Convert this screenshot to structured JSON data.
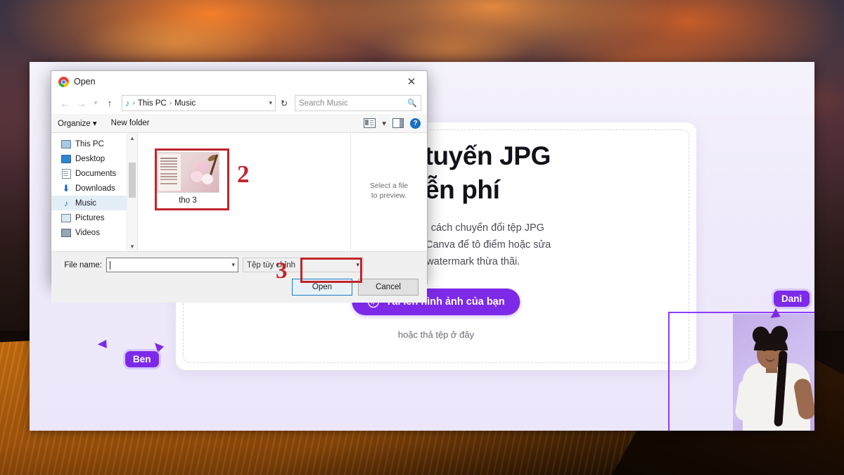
{
  "wallpaper": {
    "description": "fiery-orange-cloudy-sky-over-sand-dune"
  },
  "browser_page": {
    "heading": "…đổi trực tuyến JPG …F miễn phí",
    "heading_line1": "đổi trực tuyến JPG",
    "heading_line2": "F miễn phí",
    "paragraph_line1": "ng lượng lưu trữ bằng cách chuyển đổi tệp JPG",
    "paragraph_line2": "ảnh PDF miễn phí của Canva để tô điểm hoặc sửa",
    "paragraph_line3": "g hay phải lo về watermark thừa thãi.",
    "upload_button": "Tải lên hình ảnh của bạn",
    "upload_icon": "cloud-upload-icon",
    "drop_hint": "hoặc thả tệp ở đây",
    "accent_color": "#7d2ae8",
    "collaborators": [
      {
        "name": "Dani",
        "cursor_color": "#7d2ae8"
      },
      {
        "name": "Ben",
        "cursor_color": "#7d2ae8"
      }
    ]
  },
  "dialog": {
    "title": "Open",
    "title_icon": "chrome-icon",
    "close_label": "✕",
    "nav": {
      "back_icon": "arrow-left-icon",
      "forward_icon": "arrow-right-icon",
      "recent_icon": "chevron-down-icon",
      "up_icon": "arrow-up-icon",
      "breadcrumb_icon": "music-note-icon",
      "breadcrumb": [
        "This PC",
        "Music"
      ],
      "separator": "›",
      "dropdown_icon": "chevron-down-icon",
      "refresh_icon": "↻",
      "search_placeholder": "Search Music",
      "search_value": "",
      "search_icon": "magnifier-icon"
    },
    "toolbar": {
      "organize": "Organize",
      "organize_caret": "▾",
      "new_folder": "New folder",
      "view_icon": "view-layout-icon",
      "view_caret": "▾",
      "pane_icon": "preview-pane-icon",
      "help_icon": "help-icon",
      "help_glyph": "?"
    },
    "sidebar": [
      {
        "label": "This PC",
        "icon": "this-pc-icon",
        "selected": false
      },
      {
        "label": "Desktop",
        "icon": "desktop-icon",
        "selected": false
      },
      {
        "label": "Documents",
        "icon": "documents-icon",
        "selected": false
      },
      {
        "label": "Downloads",
        "icon": "downloads-icon",
        "selected": false
      },
      {
        "label": "Music",
        "icon": "music-icon",
        "selected": true
      },
      {
        "label": "Pictures",
        "icon": "pictures-icon",
        "selected": false
      },
      {
        "label": "Videos",
        "icon": "videos-icon",
        "selected": false
      }
    ],
    "files": [
      {
        "name": "tho 3",
        "icon": "image-thumbnail"
      }
    ],
    "preview": {
      "line1": "Select a file",
      "line2": "to preview."
    },
    "filename": {
      "label": "File name:",
      "value": "",
      "caret": true,
      "dropdown_icon": "chevron-down-icon"
    },
    "filter": {
      "value": "Tệp tùy chỉnh",
      "dropdown_icon": "chevron-down-icon"
    },
    "buttons": {
      "open": "Open",
      "cancel": "Cancel"
    }
  },
  "annotations": [
    {
      "number": "2",
      "target": "file-thumbnail"
    },
    {
      "number": "3",
      "target": "open-button"
    }
  ],
  "colors": {
    "annotation_red": "#c0252c",
    "canva_purple": "#7d2ae8",
    "focus_blue": "#1a7cc4"
  }
}
